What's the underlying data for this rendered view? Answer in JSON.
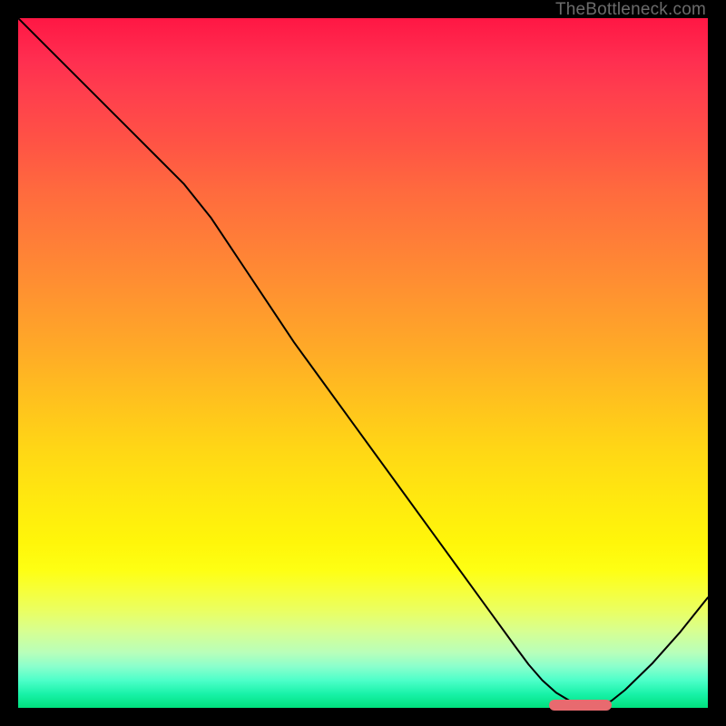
{
  "watermark": "TheBottleneck.com",
  "chart_data": {
    "type": "line",
    "title": "",
    "xlabel": "",
    "ylabel": "",
    "xlim": [
      0,
      100
    ],
    "ylim": [
      0,
      100
    ],
    "grid": false,
    "legend": false,
    "series": [
      {
        "name": "bottleneck-curve",
        "x": [
          0,
          4,
          8,
          12,
          16,
          20,
          24,
          28,
          32,
          36,
          40,
          44,
          48,
          52,
          56,
          60,
          64,
          68,
          72,
          74,
          76,
          78,
          80,
          82,
          84,
          86,
          88,
          92,
          96,
          100
        ],
        "y": [
          100,
          96,
          92,
          88,
          84,
          80,
          76,
          71,
          65,
          59,
          53,
          47.5,
          42,
          36.5,
          31,
          25.5,
          20,
          14.5,
          9,
          6.3,
          4,
          2.2,
          1,
          0.4,
          0.4,
          1,
          2.6,
          6.5,
          11,
          16
        ]
      }
    ],
    "annotations": [
      {
        "name": "optimal-range-marker",
        "x_start": 77,
        "x_end": 86,
        "y": 0.4,
        "color": "#e86a6f"
      }
    ],
    "background_gradient": {
      "top": "#ff1744",
      "mid": "#ffe90f",
      "bottom": "#00e07d"
    }
  },
  "marker_style": {
    "left_pct": 77,
    "width_pct": 9,
    "bottom_pct": 0.4
  }
}
